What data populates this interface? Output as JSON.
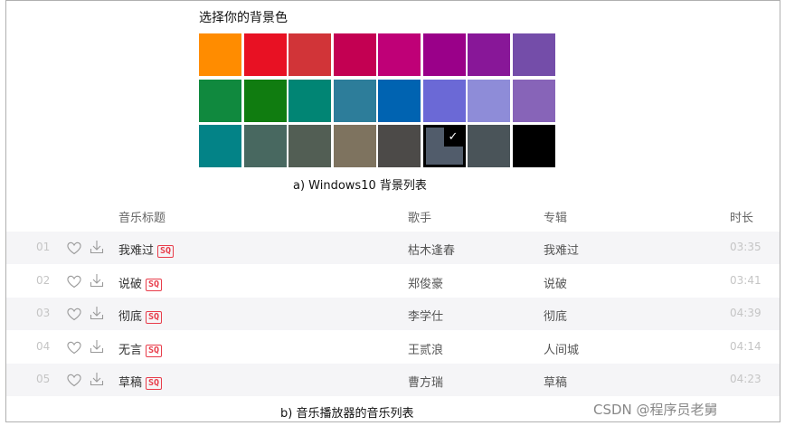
{
  "picker": {
    "title": "选择你的背景色",
    "selected_index": 21,
    "swatches": [
      "#ff8c00",
      "#e81123",
      "#d13438",
      "#c30052",
      "#bf0077",
      "#9a0089",
      "#881798",
      "#744da9",
      "#10893e",
      "#107c10",
      "#018574",
      "#2d7d9a",
      "#0063b1",
      "#6b69d6",
      "#8e8cd8",
      "#8764b8",
      "#038387",
      "#486860",
      "#525e54",
      "#7e735f",
      "#4c4a48",
      "#515c6b",
      "#4a5459",
      "#000000"
    ],
    "check_glyph": "✓"
  },
  "caption_a": "a) Windows10 背景列表",
  "caption_b": "b) 音乐播放器的音乐列表",
  "list": {
    "headers": {
      "title": "音乐标题",
      "singer": "歌手",
      "album": "专辑",
      "duration": "时长"
    },
    "sq_badge": "SQ",
    "rows": [
      {
        "index": "01",
        "title": "我难过",
        "singer": "枯木逢春",
        "album": "我难过",
        "duration": "03:35"
      },
      {
        "index": "02",
        "title": "说破",
        "singer": "郑俊豪",
        "album": "说破",
        "duration": "03:41"
      },
      {
        "index": "03",
        "title": "彻底",
        "singer": "李学仕",
        "album": "彻底",
        "duration": "04:39"
      },
      {
        "index": "04",
        "title": "无言",
        "singer": "王贰浪",
        "album": "人间城",
        "duration": "04:14"
      },
      {
        "index": "05",
        "title": "草稿",
        "singer": "曹方瑞",
        "album": "草稿",
        "duration": "04:23"
      }
    ]
  },
  "watermark": "CSDN @程序员老舅",
  "colors": {
    "row_alt": "#f5f5f7",
    "sq_red": "#e83c4a",
    "muted": "#c5c5c5"
  },
  "icons": {
    "heart": "heart-icon",
    "download": "download-icon",
    "check": "check-icon"
  }
}
